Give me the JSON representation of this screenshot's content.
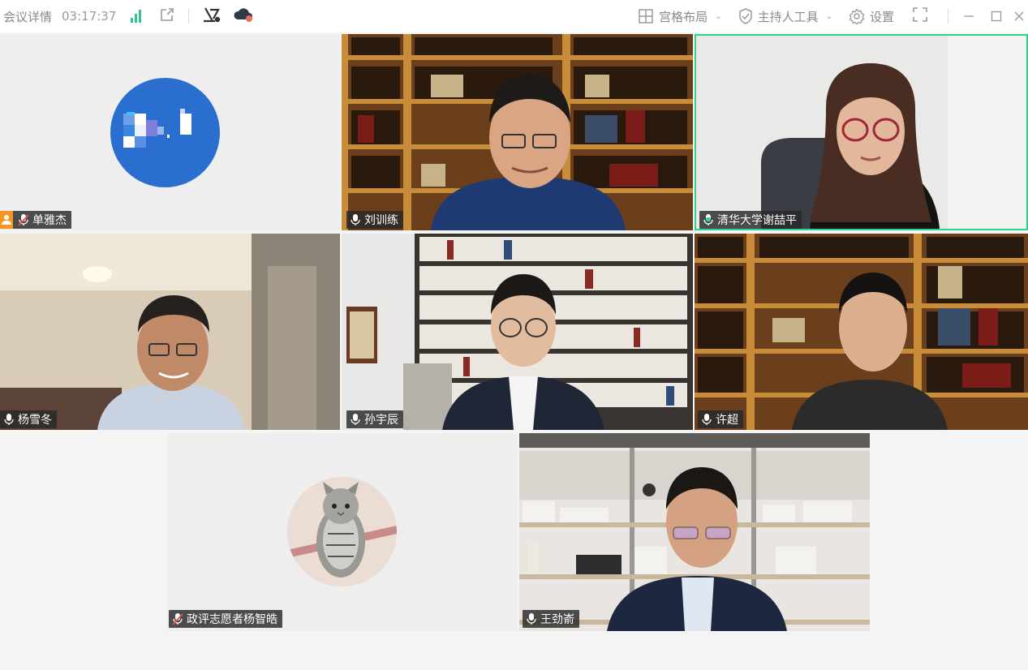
{
  "toolbar": {
    "meeting_details": "会议详情",
    "duration": "03:17:37",
    "layout_label": "宫格布局",
    "host_tools_label": "主持人工具",
    "settings_label": "设置"
  },
  "participants": [
    {
      "name": "单雅杰",
      "mic": "muted",
      "host": true
    },
    {
      "name": "刘训练",
      "mic": "on"
    },
    {
      "name": "清华大学谢喆平",
      "mic": "on",
      "active_speaker": true
    },
    {
      "name": "杨雪冬",
      "mic": "on"
    },
    {
      "name": "孙宇辰",
      "mic": "on"
    },
    {
      "name": "许超",
      "mic": "on"
    },
    {
      "name": "政评志愿者杨智皓",
      "mic": "muted"
    },
    {
      "name": "王劲嵛",
      "mic": "on"
    }
  ],
  "colors": {
    "active_speaker_border": "#2fd28a",
    "host_badge": "#f7931e",
    "signal": "#34c38f",
    "avatar_blue": "#2a6fd0"
  }
}
